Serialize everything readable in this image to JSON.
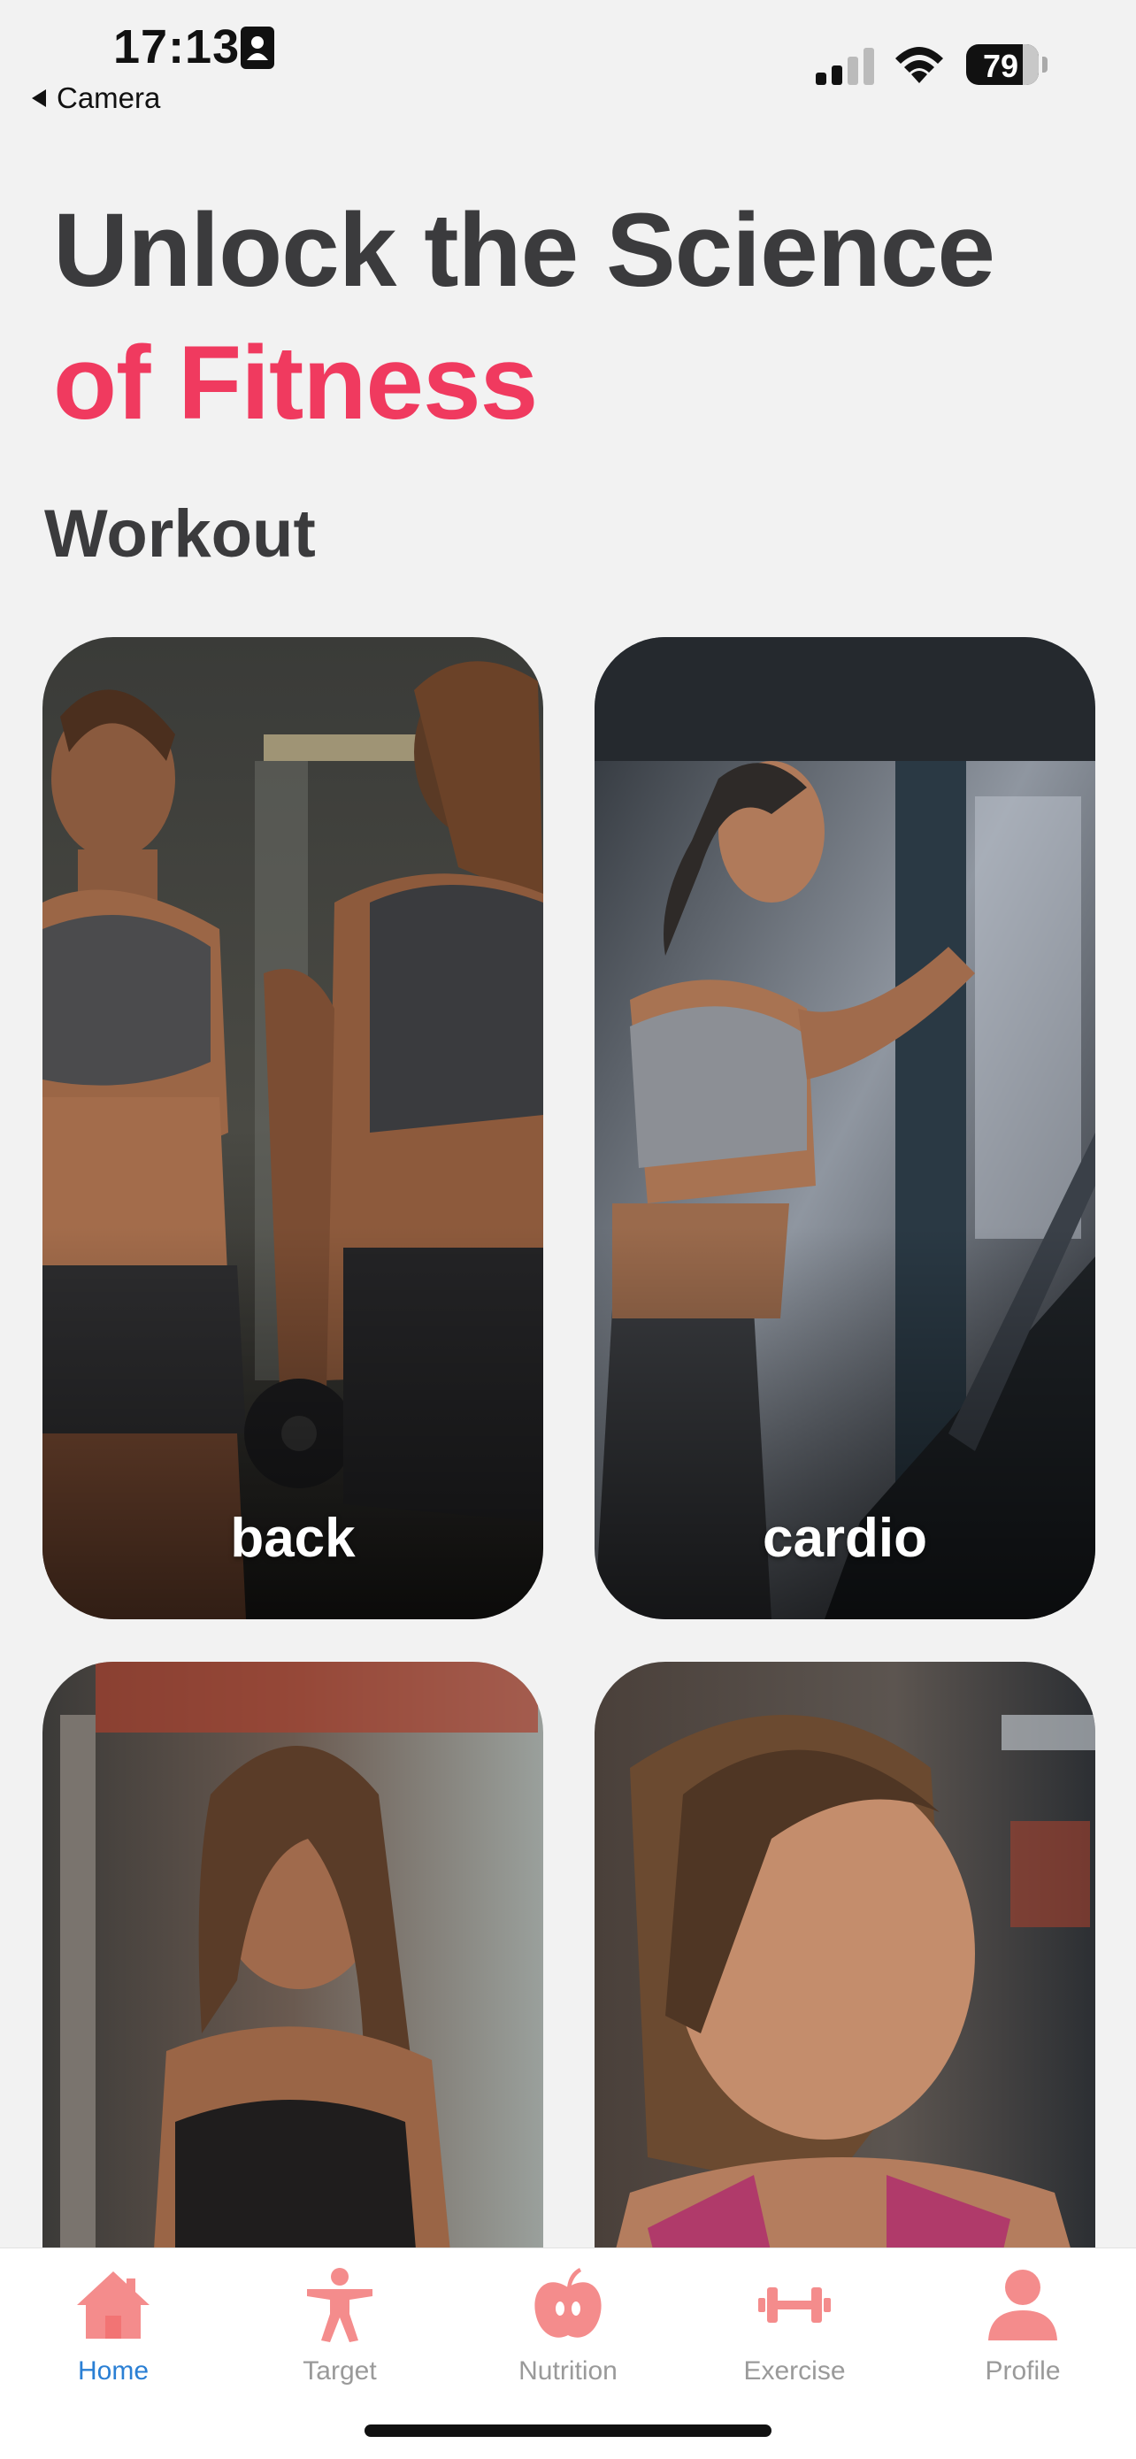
{
  "status_bar": {
    "time": "17:13",
    "back_app": "Camera",
    "battery": "79"
  },
  "hero": {
    "line1": "Unlock the Science",
    "line2": "of Fitness"
  },
  "section": {
    "title": "Workout"
  },
  "cards": [
    {
      "label": "back"
    },
    {
      "label": "cardio"
    },
    {
      "label": ""
    },
    {
      "label": ""
    }
  ],
  "tab_bar": {
    "tabs": [
      {
        "label": "Home",
        "icon": "home-icon",
        "active": true
      },
      {
        "label": "Target",
        "icon": "target-person-icon",
        "active": false
      },
      {
        "label": "Nutrition",
        "icon": "apple-icon",
        "active": false
      },
      {
        "label": "Exercise",
        "icon": "dumbbell-icon",
        "active": false
      },
      {
        "label": "Profile",
        "icon": "profile-icon",
        "active": false
      }
    ]
  },
  "colors": {
    "accent": "#f03a5f",
    "tab_icon": "#f48c8c",
    "tab_active_label": "#2a7fd4",
    "heading": "#3b3b3d",
    "background": "#f2f2f2"
  }
}
